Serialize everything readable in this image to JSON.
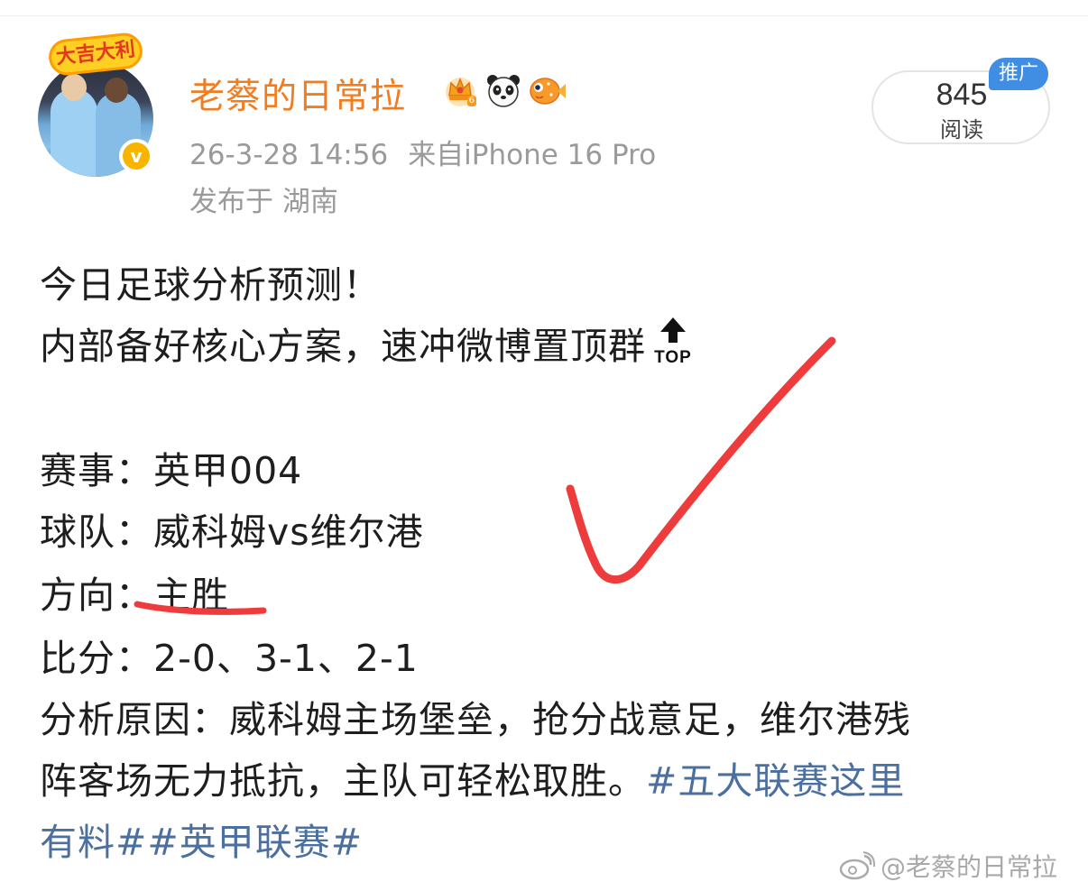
{
  "header": {
    "frame_badge_text": "大吉大利",
    "verified_mark": "v",
    "username": "老蔡的日常拉",
    "level_badge": "6",
    "timestamp": "26-3-28 14:56",
    "source": "来自iPhone 16 Pro",
    "location": "发布于 湖南",
    "read_count": "845",
    "read_label": "阅读",
    "promo_tag": "推广",
    "icons": [
      "crown-level-icon",
      "panda-icon",
      "pufferfish-icon"
    ]
  },
  "post": {
    "line1": "今日足球分析预测！",
    "line2": "内部备好核心方案，速冲微博置顶群",
    "top_sticker_label": "TOP",
    "match_label": "赛事：",
    "match_value": "英甲004",
    "teams_label": "球队：",
    "teams_value": "威科姆vs维尔港",
    "direction_label": "方向：",
    "direction_value": "主胜",
    "score_label": "比分：",
    "score_value": "2-0、3-1、2-1",
    "reason_line1": "分析原因：威科姆主场堡垒，抢分战意足，维尔港残",
    "reason_line2_text": "阵客场无力抵抗，主队可轻松取胜。",
    "hashtag1_part1": "#五大联赛这里",
    "hashtag1_part2": "有料#",
    "hashtag2": "#英甲联赛#"
  },
  "watermark": "@老蔡的日常拉",
  "colors": {
    "username": "#f27d21",
    "meta": "#9a9a9a",
    "hashtag": "#4b6f9e",
    "promo": "#3f8ee4",
    "annotation": "#ee3b3b"
  }
}
